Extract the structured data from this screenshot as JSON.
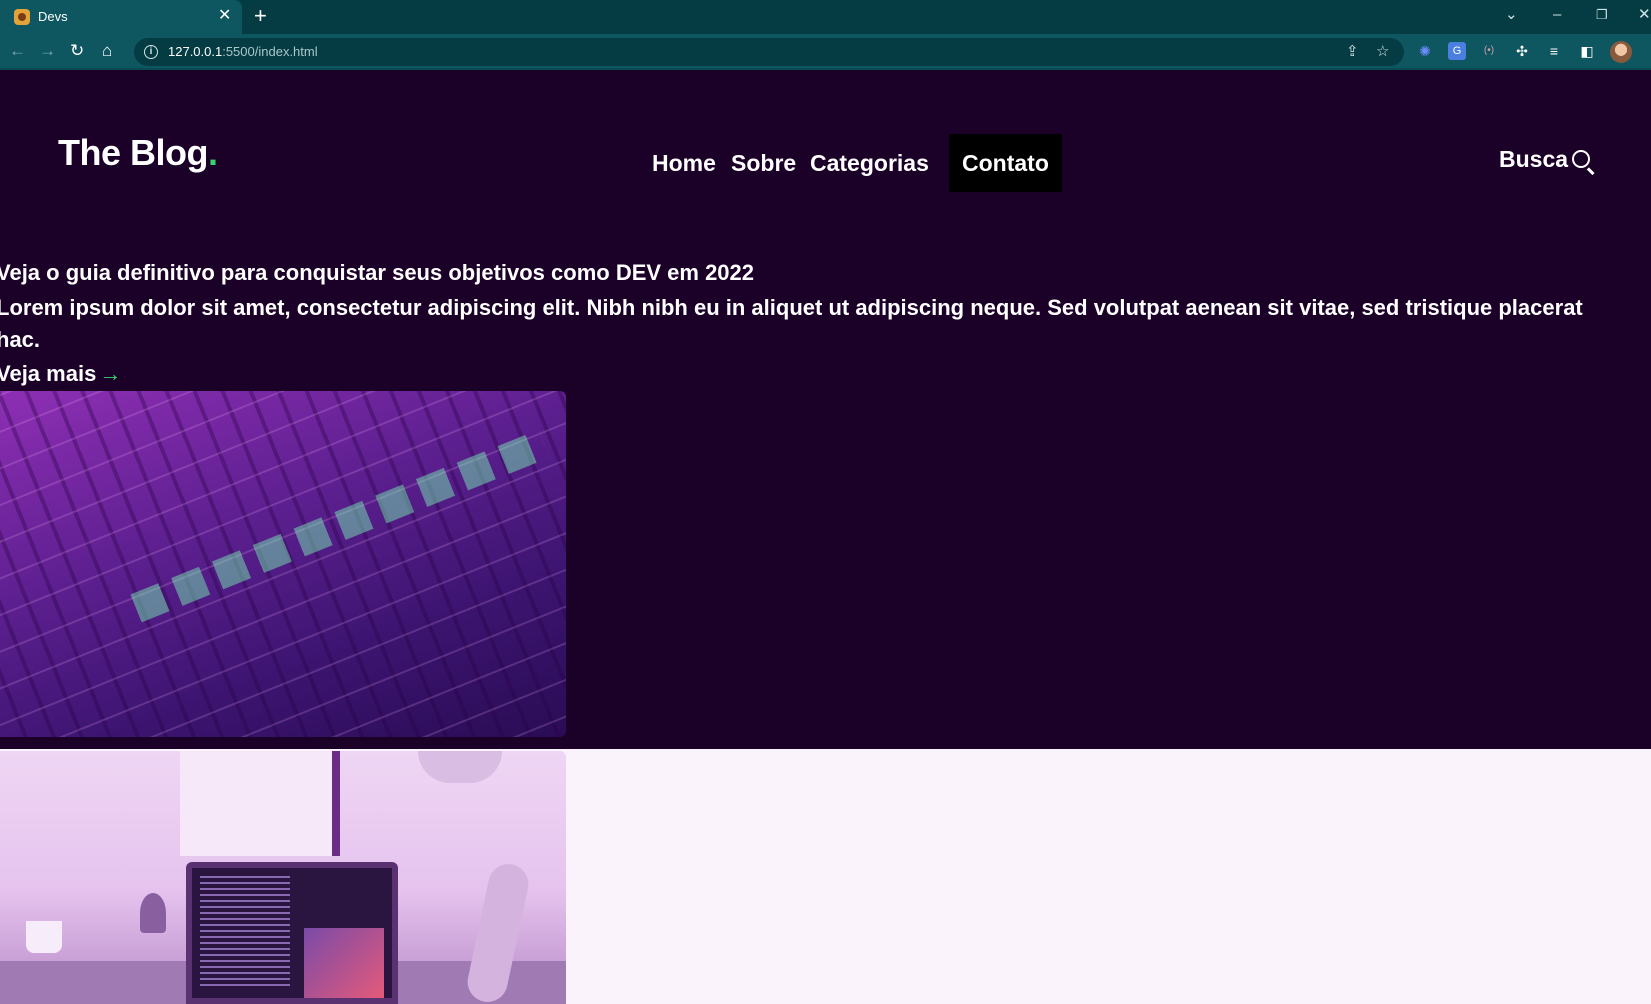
{
  "browser": {
    "tab_title": "Devs",
    "tab_close": "✕",
    "new_tab": "+",
    "url_host": "127.0.0.1",
    "url_path": ":5500/index.html",
    "window_controls": {
      "tabs_menu": "⌄",
      "minimize": "–",
      "restore": "❐",
      "close": "✕"
    }
  },
  "header": {
    "logo_text": "The Blog",
    "logo_dot": ".",
    "nav": [
      {
        "label": "Home"
      },
      {
        "label": "Sobre"
      },
      {
        "label": "Categorias"
      },
      {
        "label": "Contato",
        "active": true
      }
    ],
    "search_label": "Busca"
  },
  "hero": {
    "title": "Veja o guia definitivo para conquistar seus objetivos como DEV em 2022",
    "description": "Lorem ipsum dolor sit amet, consectetur adipiscing elit. Nibh nibh eu in aliquet ut adipiscing neque. Sed volutpat aenean sit vitae, sed tristique placerat hac.",
    "cta_label": "Veja mais",
    "cta_arrow": "→"
  },
  "colors": {
    "hero_background": "#1b0128",
    "page_background": "#faf3fb",
    "accent_green": "#37d36b",
    "browser_frame": "#0e5660"
  }
}
